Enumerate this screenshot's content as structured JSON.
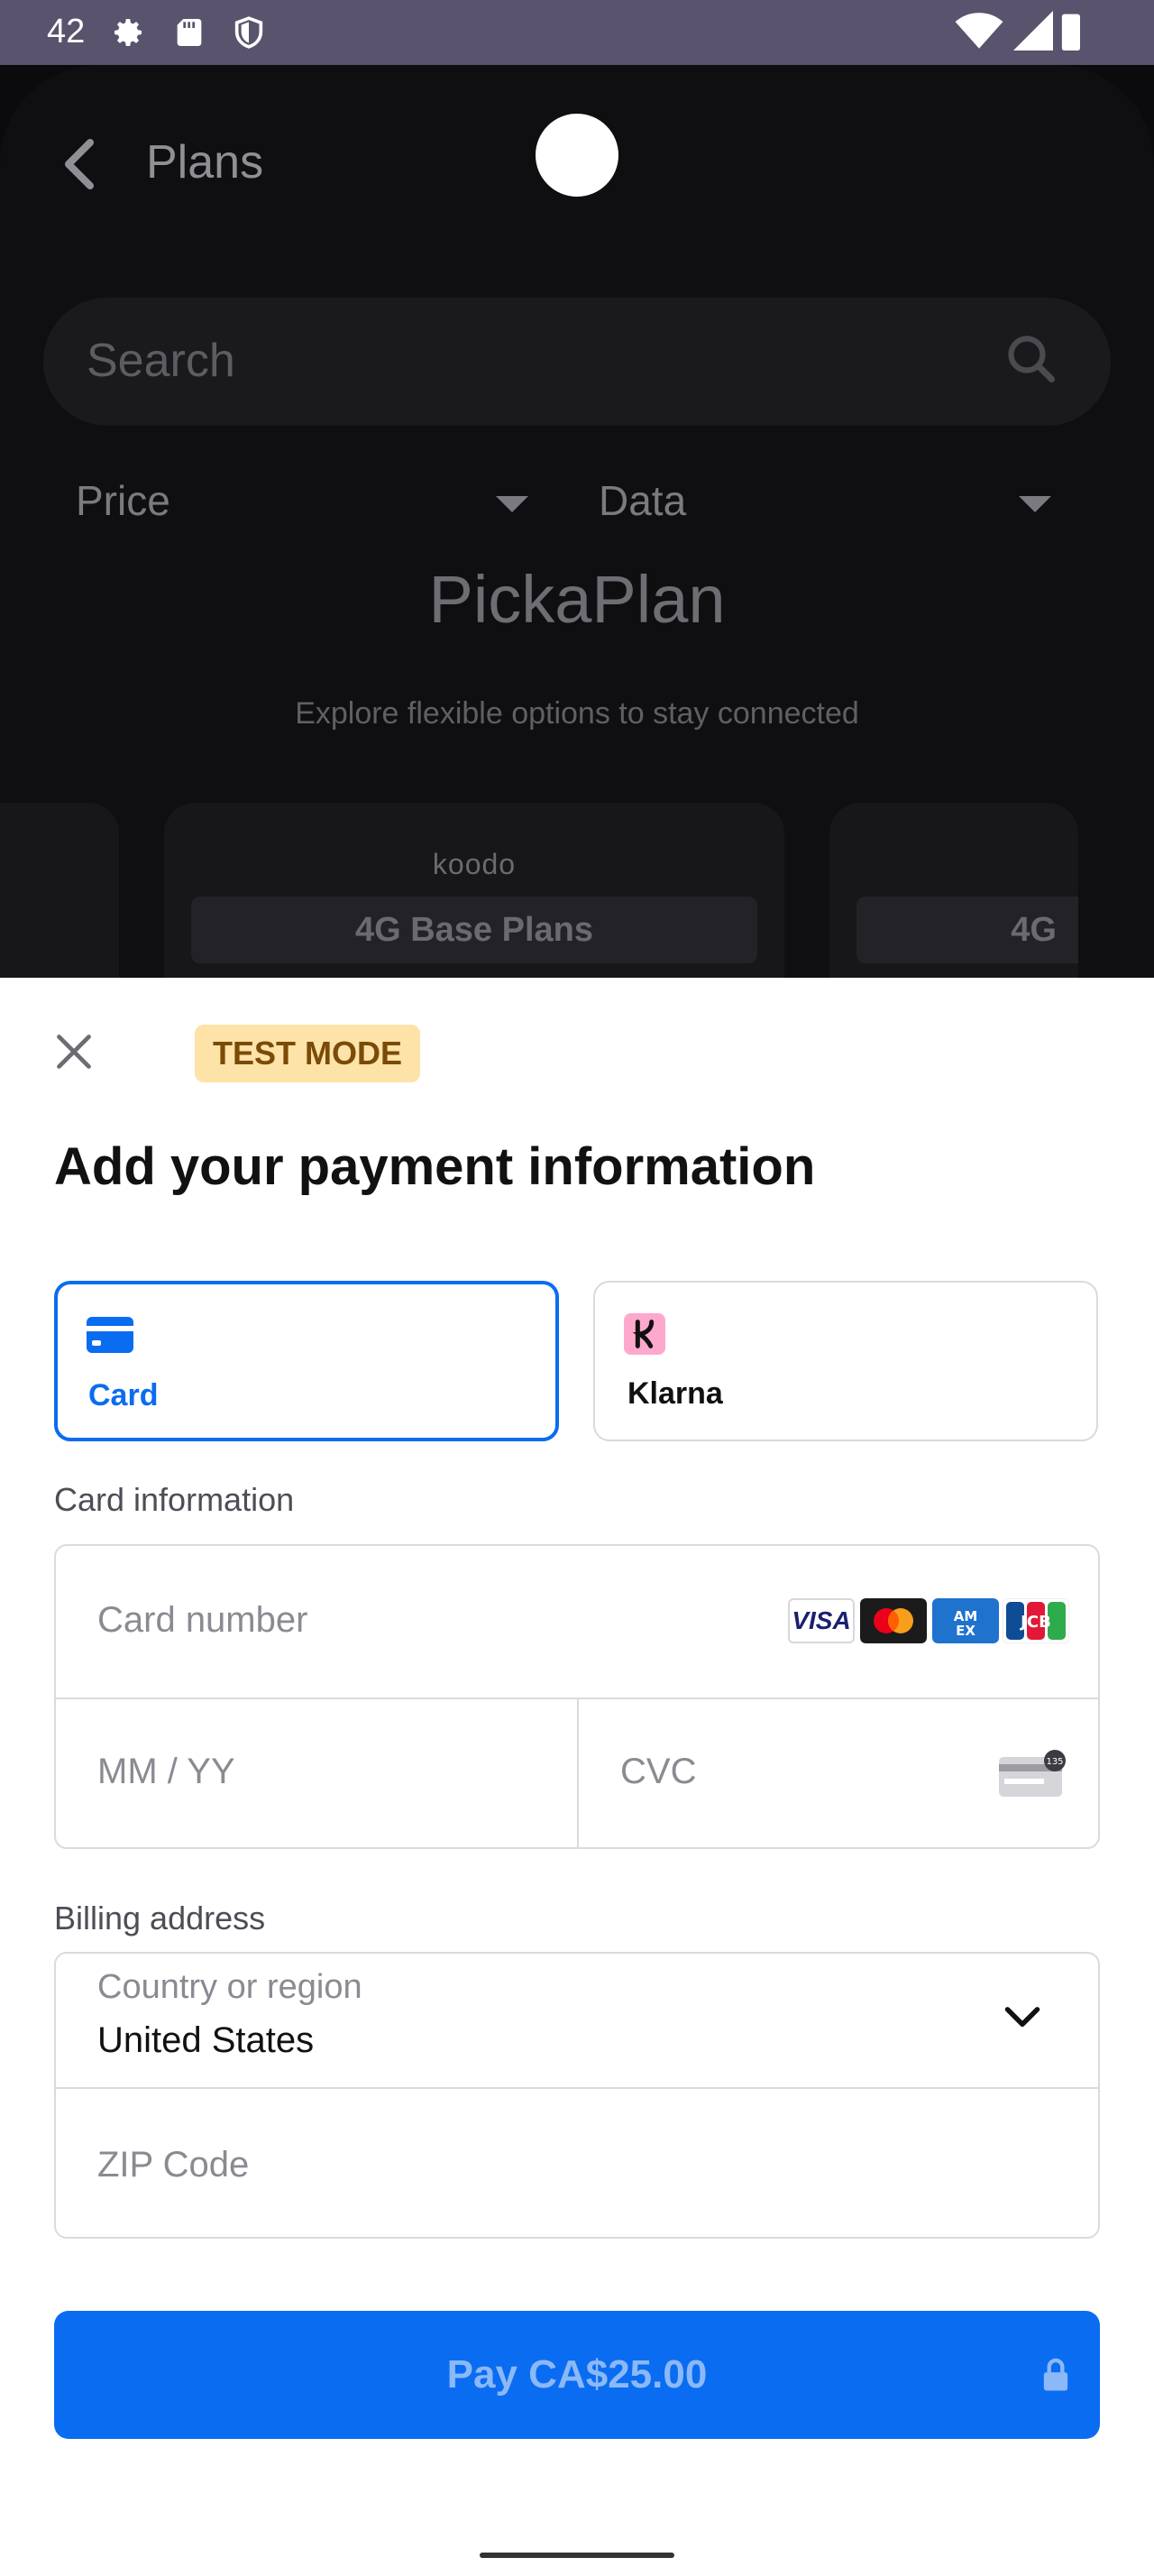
{
  "status_bar": {
    "time": "42"
  },
  "app": {
    "title": "Plans",
    "search_placeholder": "Search",
    "filters": {
      "price_label": "Price",
      "data_label": "Data"
    },
    "hero_title": "PickaPlan",
    "hero_subtitle": "Explore flexible options to stay connected",
    "plan_cards": [
      {
        "brand": "koodo",
        "plan": "4G Base Plans"
      },
      {
        "brand": "",
        "plan": "4G"
      }
    ]
  },
  "sheet": {
    "test_mode": "TEST MODE",
    "title": "Add your payment information",
    "methods": [
      {
        "label": "Card",
        "icon": "card-icon",
        "selected": true
      },
      {
        "label": "Klarna",
        "icon": "klarna-icon",
        "selected": false
      }
    ],
    "card_info_label": "Card information",
    "card_number_placeholder": "Card number",
    "card_brands": [
      "VISA",
      "Mastercard",
      "AMEX",
      "JCB"
    ],
    "expiry_placeholder": "MM / YY",
    "cvc_placeholder": "CVC",
    "cvc_hint": "135",
    "billing_label": "Billing address",
    "country_label": "Country or region",
    "country_value": "United States",
    "zip_placeholder": "ZIP Code",
    "pay_label": "Pay CA$25.00"
  },
  "colors": {
    "accent": "#0a6cf1",
    "test_badge_bg": "#fde3a7",
    "status_bar_bg": "#59536d"
  }
}
